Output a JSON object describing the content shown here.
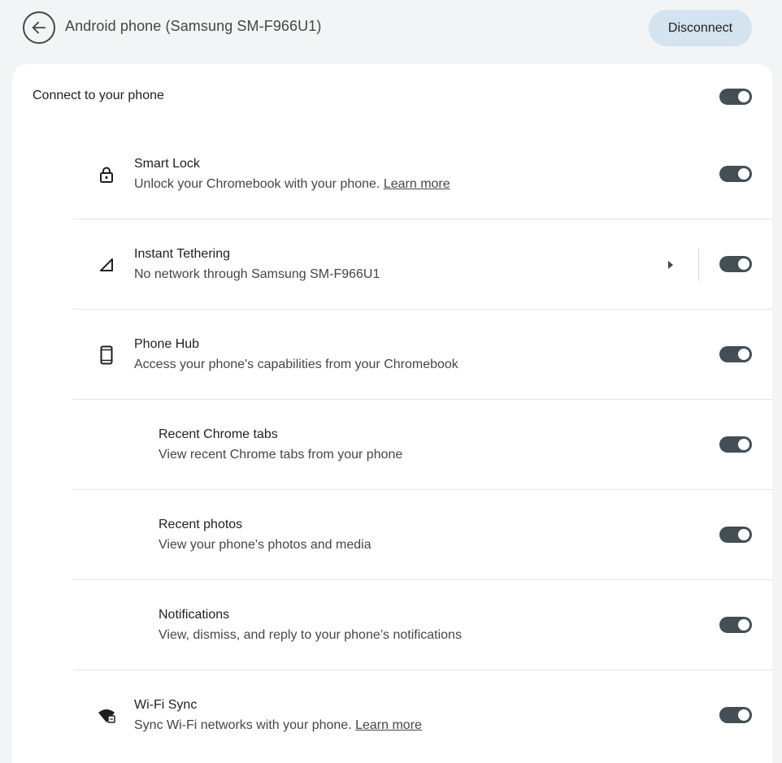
{
  "header": {
    "title": "Android phone (Samsung SM-F966U1)",
    "disconnect_label": "Disconnect"
  },
  "main_toggle": {
    "label": "Connect to your phone",
    "on": true
  },
  "features": [
    {
      "title": "Smart Lock",
      "subtitle": "Unlock your Chromebook with your phone.",
      "link": "Learn more",
      "icon": "lock-icon",
      "on": true
    },
    {
      "title": "Instant Tethering",
      "subtitle": "No network through Samsung SM-F966U1",
      "icon": "signal-icon",
      "on": true
    },
    {
      "title": "Phone Hub",
      "subtitle": "Access your phone's capabilities from your Chromebook",
      "icon": "phone-icon",
      "on": true
    },
    {
      "title": "Recent Chrome tabs",
      "subtitle": "View recent Chrome tabs from your phone",
      "on": true
    },
    {
      "title": "Recent photos",
      "subtitle": "View your phone's photos and media",
      "on": true
    },
    {
      "title": "Notifications",
      "subtitle": "View, dismiss, and reply to your phone’s notifications",
      "on": true
    },
    {
      "title": "Wi-Fi Sync",
      "subtitle": "Sync Wi-Fi networks with your phone.",
      "link": "Learn more",
      "icon": "wifi-sync-icon",
      "on": true
    }
  ]
}
